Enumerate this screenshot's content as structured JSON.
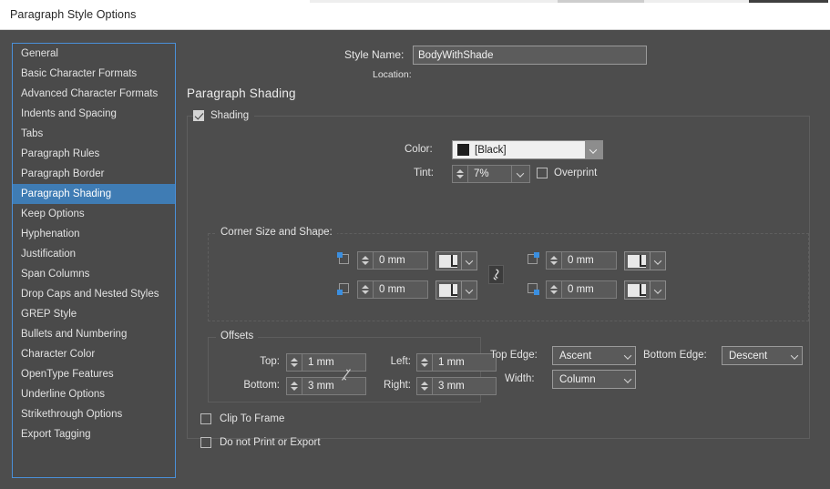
{
  "window": {
    "title": "Paragraph Style Options"
  },
  "sidebar": {
    "items": [
      {
        "label": "General",
        "selected": false
      },
      {
        "label": "Basic Character Formats",
        "selected": false
      },
      {
        "label": "Advanced Character Formats",
        "selected": false
      },
      {
        "label": "Indents and Spacing",
        "selected": false
      },
      {
        "label": "Tabs",
        "selected": false
      },
      {
        "label": "Paragraph Rules",
        "selected": false
      },
      {
        "label": "Paragraph Border",
        "selected": false
      },
      {
        "label": "Paragraph Shading",
        "selected": true
      },
      {
        "label": "Keep Options",
        "selected": false
      },
      {
        "label": "Hyphenation",
        "selected": false
      },
      {
        "label": "Justification",
        "selected": false
      },
      {
        "label": "Span Columns",
        "selected": false
      },
      {
        "label": "Drop Caps and Nested Styles",
        "selected": false
      },
      {
        "label": "GREP Style",
        "selected": false
      },
      {
        "label": "Bullets and Numbering",
        "selected": false
      },
      {
        "label": "Character Color",
        "selected": false
      },
      {
        "label": "OpenType Features",
        "selected": false
      },
      {
        "label": "Underline Options",
        "selected": false
      },
      {
        "label": "Strikethrough Options",
        "selected": false
      },
      {
        "label": "Export Tagging",
        "selected": false
      }
    ],
    "selection_color": "#3f7cb4",
    "border_color": "#4a90d9"
  },
  "header": {
    "style_name_label": "Style Name:",
    "style_name_value": "BodyWithShade",
    "style_name_placeholder": "Style Name",
    "location_label": "Location:",
    "location_value": ""
  },
  "main": {
    "section_title": "Paragraph Shading",
    "shading": {
      "label": "Shading",
      "checked": true
    },
    "color": {
      "label": "Color:",
      "value": "[Black]",
      "swatch": "#1d1d1d"
    },
    "tint": {
      "label": "Tint:",
      "value": "7%"
    },
    "overprint": {
      "label": "Overprint",
      "checked": false
    },
    "corner": {
      "legend": "Corner Size and Shape:",
      "link_label": "link-corner-values",
      "fields": [
        {
          "corner": "top-left",
          "value": "0 mm",
          "shape": "none"
        },
        {
          "corner": "bottom-left",
          "value": "0 mm",
          "shape": "none"
        },
        {
          "corner": "top-right",
          "value": "0 mm",
          "shape": "none"
        },
        {
          "corner": "bottom-right",
          "value": "0 mm",
          "shape": "none"
        }
      ]
    },
    "offsets": {
      "legend": "Offsets",
      "top": {
        "label": "Top:",
        "value": "1 mm"
      },
      "bottom": {
        "label": "Bottom:",
        "value": "3 mm"
      },
      "left": {
        "label": "Left:",
        "value": "1 mm"
      },
      "right": {
        "label": "Right:",
        "value": "3 mm"
      },
      "link_label": "link-offset-values"
    },
    "edges": {
      "top_edge": {
        "label": "Top Edge:",
        "value": "Ascent"
      },
      "bottom_edge": {
        "label": "Bottom Edge:",
        "value": "Descent"
      },
      "width": {
        "label": "Width:",
        "value": "Column"
      }
    },
    "clip_to_frame": {
      "label": "Clip To Frame",
      "checked": false
    },
    "do_not_print": {
      "label": "Do not Print or Export",
      "checked": false
    }
  },
  "colors": {
    "dialog_bg": "#4d4d4d",
    "accent": "#3b8fe0",
    "field_light": "#f0f0f0"
  }
}
